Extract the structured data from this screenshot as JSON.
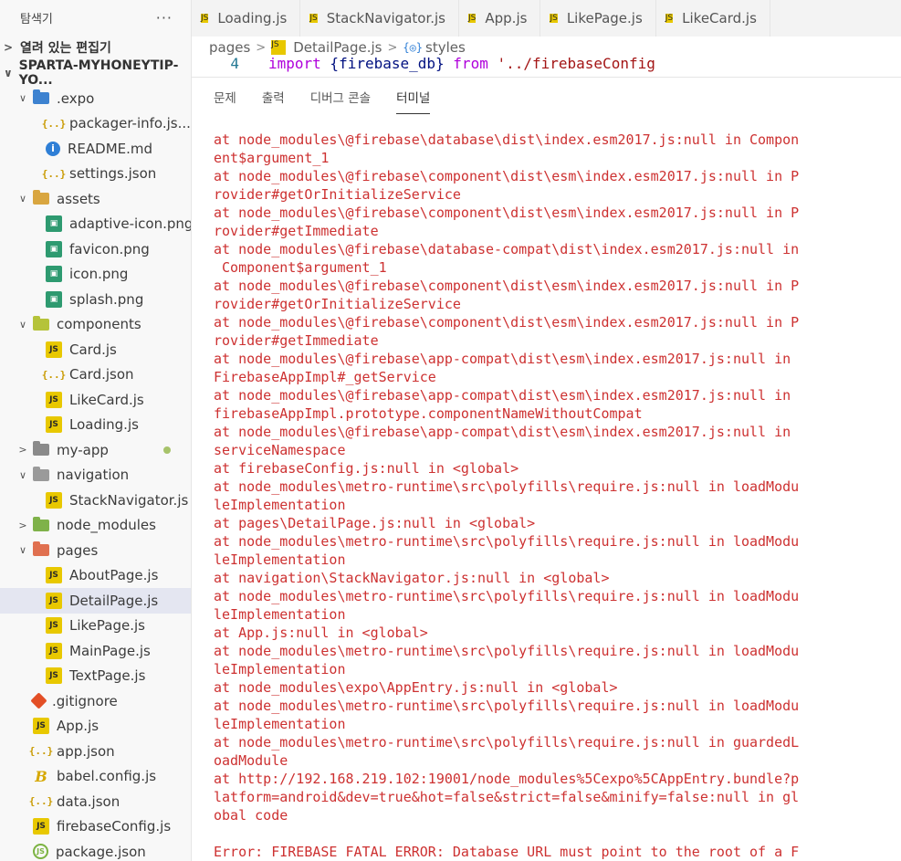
{
  "sidebar": {
    "title": "탐색기",
    "more": "···",
    "open_editors": "열려 있는 편집기",
    "project": "SPARTA-MYHONEYTIP-YO...",
    "tree": [
      {
        "label": ".expo",
        "kind": "folder-expo",
        "depth": 1,
        "twist": "∨"
      },
      {
        "label": "packager-info.js...",
        "kind": "json",
        "depth": 2
      },
      {
        "label": "README.md",
        "kind": "info",
        "depth": 2
      },
      {
        "label": "settings.json",
        "kind": "json",
        "depth": 2
      },
      {
        "label": "assets",
        "kind": "folder-assets",
        "depth": 1,
        "twist": "∨"
      },
      {
        "label": "adaptive-icon.png",
        "kind": "img",
        "depth": 2
      },
      {
        "label": "favicon.png",
        "kind": "img",
        "depth": 2
      },
      {
        "label": "icon.png",
        "kind": "img",
        "depth": 2
      },
      {
        "label": "splash.png",
        "kind": "img",
        "depth": 2
      },
      {
        "label": "components",
        "kind": "folder-comp",
        "depth": 1,
        "twist": "∨"
      },
      {
        "label": "Card.js",
        "kind": "js",
        "depth": 2
      },
      {
        "label": "Card.json",
        "kind": "json",
        "depth": 2
      },
      {
        "label": "LikeCard.js",
        "kind": "js",
        "depth": 2
      },
      {
        "label": "Loading.js",
        "kind": "js",
        "depth": 2
      },
      {
        "label": "my-app",
        "kind": "folder-myapp",
        "depth": 1,
        "twist": ">",
        "dot": true
      },
      {
        "label": "navigation",
        "kind": "folder-nav",
        "depth": 1,
        "twist": "∨"
      },
      {
        "label": "StackNavigator.js",
        "kind": "js",
        "depth": 2
      },
      {
        "label": "node_modules",
        "kind": "folder-node",
        "depth": 1,
        "twist": ">"
      },
      {
        "label": "pages",
        "kind": "folder-pages",
        "depth": 1,
        "twist": "∨"
      },
      {
        "label": "AboutPage.js",
        "kind": "js",
        "depth": 2
      },
      {
        "label": "DetailPage.js",
        "kind": "js",
        "depth": 2,
        "selected": true
      },
      {
        "label": "LikePage.js",
        "kind": "js",
        "depth": 2
      },
      {
        "label": "MainPage.js",
        "kind": "js",
        "depth": 2
      },
      {
        "label": "TextPage.js",
        "kind": "js",
        "depth": 2
      },
      {
        "label": ".gitignore",
        "kind": "git",
        "depth": 1
      },
      {
        "label": "App.js",
        "kind": "js",
        "depth": 1
      },
      {
        "label": "app.json",
        "kind": "json",
        "depth": 1
      },
      {
        "label": "babel.config.js",
        "kind": "babel",
        "depth": 1
      },
      {
        "label": "data.json",
        "kind": "json",
        "depth": 1
      },
      {
        "label": "firebaseConfig.js",
        "kind": "js",
        "depth": 1
      },
      {
        "label": "package.json",
        "kind": "npm",
        "depth": 1
      }
    ]
  },
  "tabs": [
    {
      "label": "Loading.js"
    },
    {
      "label": "StackNavigator.js"
    },
    {
      "label": "App.js"
    },
    {
      "label": "LikePage.js"
    },
    {
      "label": "LikeCard.js"
    }
  ],
  "breadcrumb": {
    "folder": "pages",
    "file": "DetailPage.js",
    "symbol_icon": "{◎}",
    "symbol": "styles"
  },
  "code": {
    "line_number": "4",
    "keyword": "import",
    "middle": " {firebase_db} ",
    "from": "from",
    "string": " '../firebaseConfig"
  },
  "panel": {
    "tabs": [
      "문제",
      "출력",
      "디버그 콘솔",
      "터미널"
    ],
    "active_tab": "터미널"
  },
  "terminal": {
    "lines": [
      "at node_modules\\@firebase\\database\\dist\\index.esm2017.js:null in Compon",
      "ent$argument_1",
      "at node_modules\\@firebase\\component\\dist\\esm\\index.esm2017.js:null in P",
      "rovider#getOrInitializeService",
      "at node_modules\\@firebase\\component\\dist\\esm\\index.esm2017.js:null in P",
      "rovider#getImmediate",
      "at node_modules\\@firebase\\database-compat\\dist\\index.esm2017.js:null in",
      " Component$argument_1",
      "at node_modules\\@firebase\\component\\dist\\esm\\index.esm2017.js:null in P",
      "rovider#getOrInitializeService",
      "at node_modules\\@firebase\\component\\dist\\esm\\index.esm2017.js:null in P",
      "rovider#getImmediate",
      "at node_modules\\@firebase\\app-compat\\dist\\esm\\index.esm2017.js:null in",
      "FirebaseAppImpl#_getService",
      "at node_modules\\@firebase\\app-compat\\dist\\esm\\index.esm2017.js:null in",
      "firebaseAppImpl.prototype.componentNameWithoutCompat",
      "at node_modules\\@firebase\\app-compat\\dist\\esm\\index.esm2017.js:null in",
      "serviceNamespace",
      "at firebaseConfig.js:null in <global>",
      "at node_modules\\metro-runtime\\src\\polyfills\\require.js:null in loadModu",
      "leImplementation",
      "at pages\\DetailPage.js:null in <global>",
      "at node_modules\\metro-runtime\\src\\polyfills\\require.js:null in loadModu",
      "leImplementation",
      "at navigation\\StackNavigator.js:null in <global>",
      "at node_modules\\metro-runtime\\src\\polyfills\\require.js:null in loadModu",
      "leImplementation",
      "at App.js:null in <global>",
      "at node_modules\\metro-runtime\\src\\polyfills\\require.js:null in loadModu",
      "leImplementation",
      "at node_modules\\expo\\AppEntry.js:null in <global>",
      "at node_modules\\metro-runtime\\src\\polyfills\\require.js:null in loadModu",
      "leImplementation",
      "at node_modules\\metro-runtime\\src\\polyfills\\require.js:null in guardedL",
      "oadModule",
      "at http://192.168.219.102:19001/node_modules%5Cexpo%5CAppEntry.bundle?p",
      "latform=android&dev=true&hot=false&strict=false&minify=false:null in gl",
      "obal code",
      "",
      "Error: FIREBASE FATAL ERROR: Database URL must point to the root of a F"
    ]
  }
}
